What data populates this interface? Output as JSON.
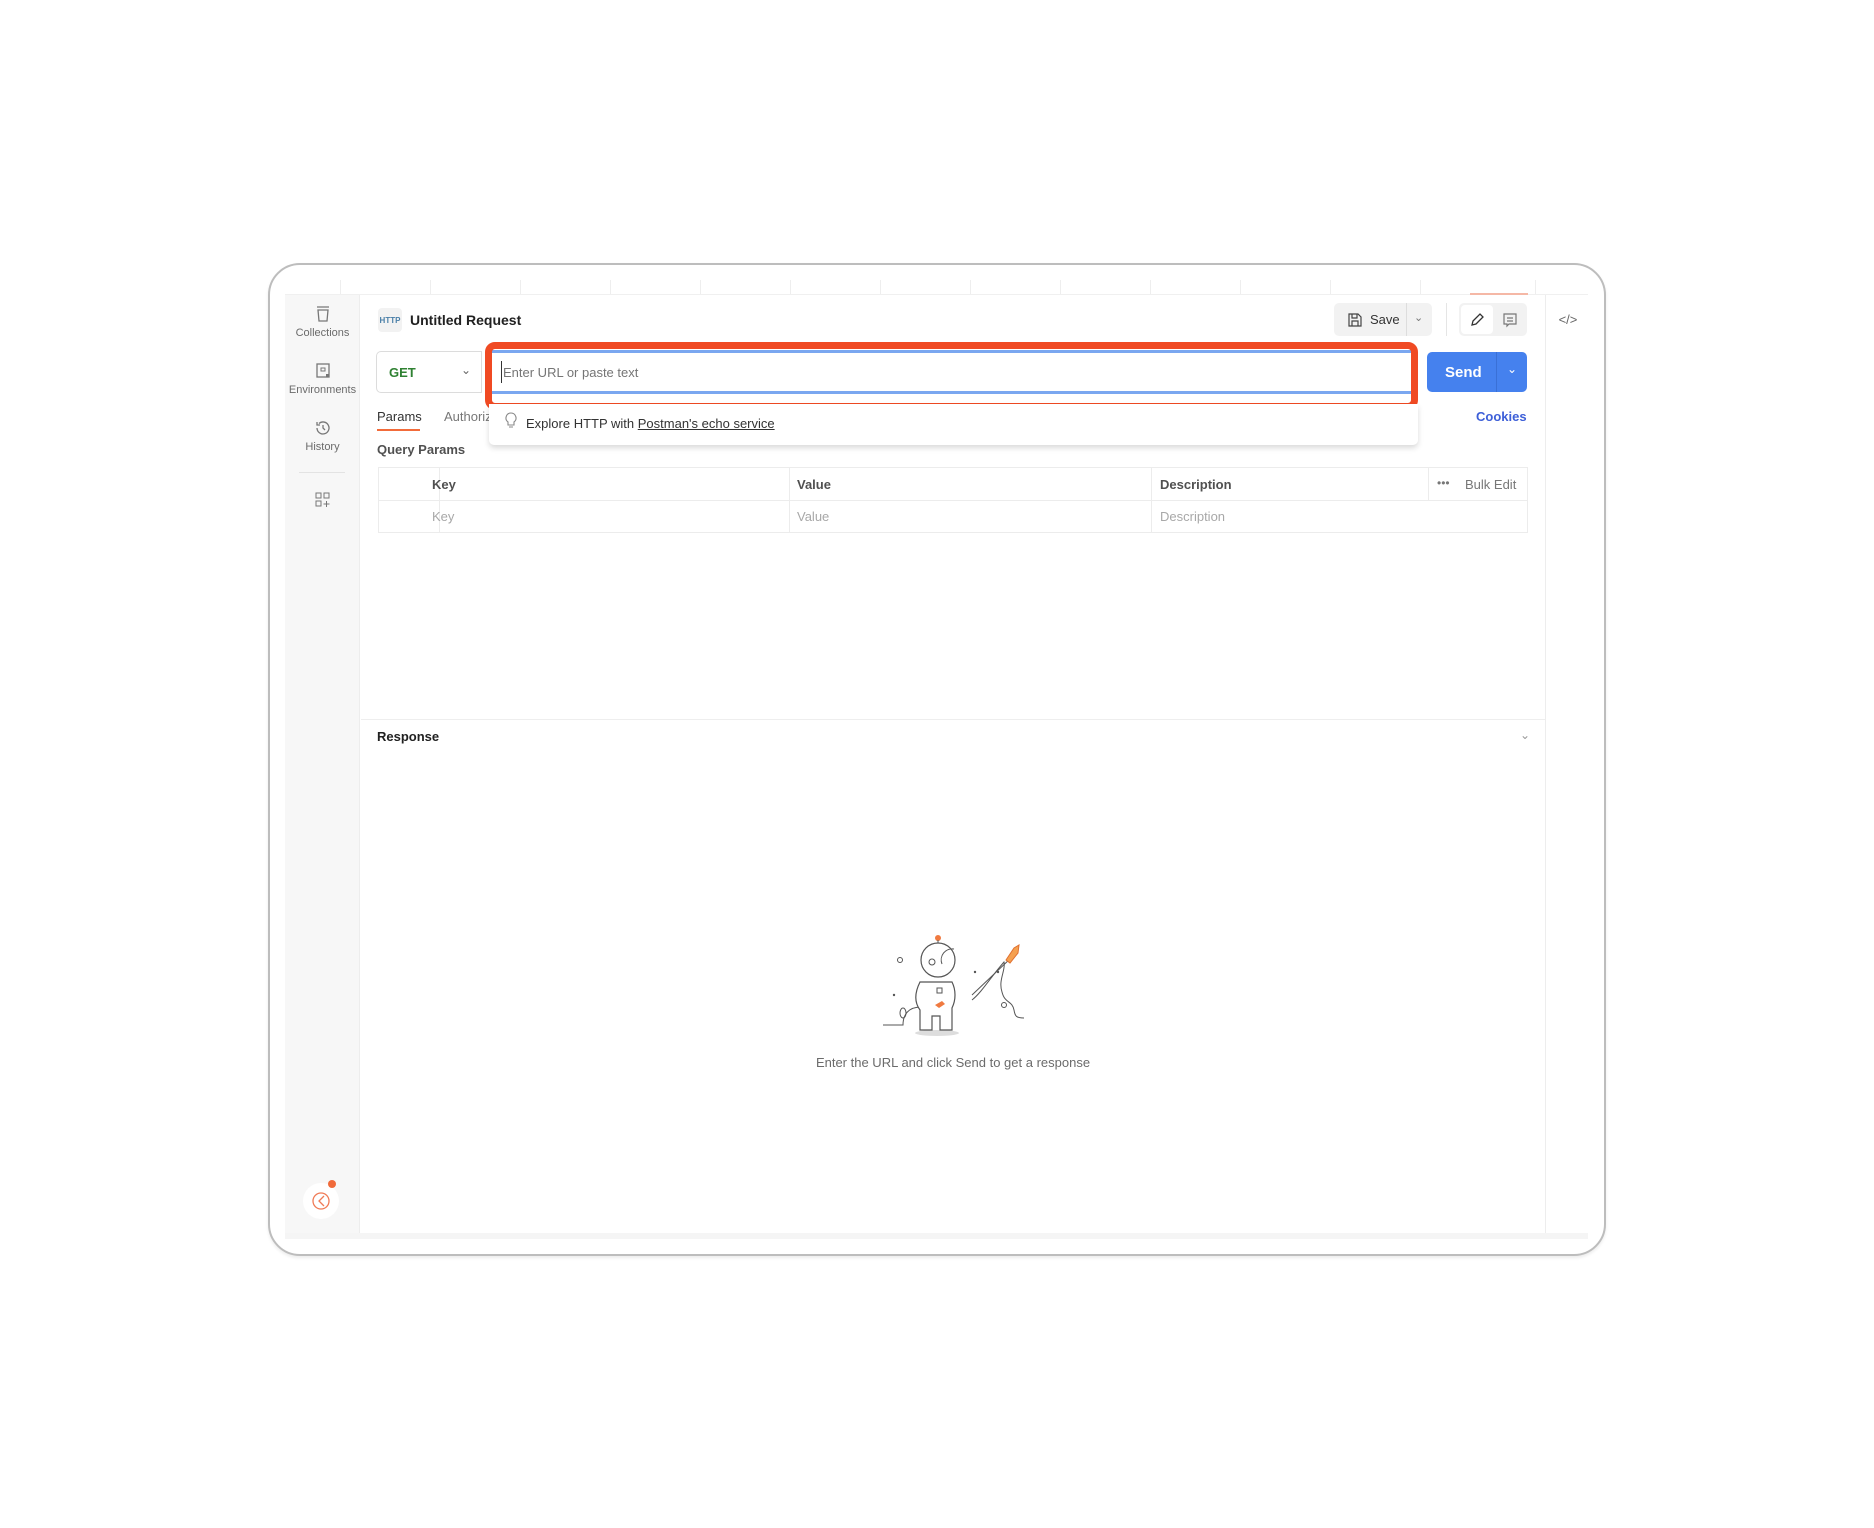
{
  "sidebar": {
    "items": [
      {
        "label": "Collections",
        "icon": "collections-icon"
      },
      {
        "label": "Environments",
        "icon": "environments-icon"
      },
      {
        "label": "History",
        "icon": "history-icon"
      },
      {
        "label": "",
        "icon": "add-apps-icon"
      }
    ]
  },
  "request": {
    "title": "Untitled Request",
    "method": "GET",
    "url_placeholder": "Enter URL or paste text",
    "url_value": "",
    "save_label": "Save",
    "send_label": "Send"
  },
  "suggestion": {
    "prefix": "Explore HTTP with ",
    "link": "Postman's echo service"
  },
  "tabs": [
    {
      "label": "Params",
      "active": true
    },
    {
      "label": "Authoriz"
    }
  ],
  "cookies_label": "Cookies",
  "params": {
    "title": "Query Params",
    "columns": [
      "Key",
      "Value",
      "Description"
    ],
    "more": "•••",
    "bulk_edit": "Bulk Edit",
    "placeholder_row": [
      "Key",
      "Value",
      "Description"
    ]
  },
  "response": {
    "title": "Response",
    "empty_message": "Enter the URL and click Send to get a response"
  },
  "colors": {
    "accent": "#ff6c37",
    "send": "#4581ee",
    "highlight": "#f04a23",
    "link": "#3d5fd8",
    "method": "#2f8132"
  }
}
